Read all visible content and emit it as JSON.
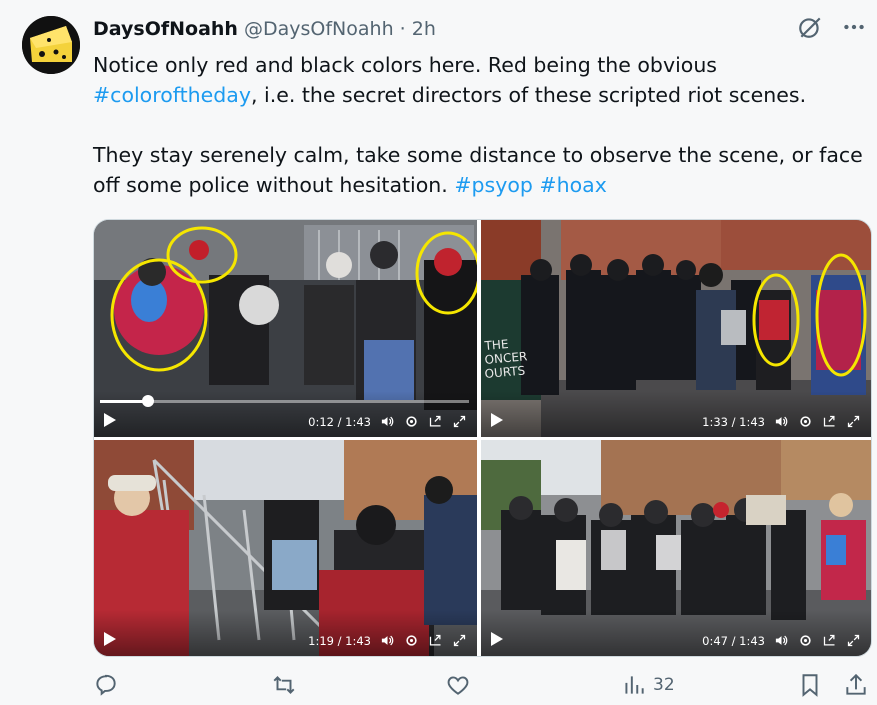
{
  "tweet": {
    "display_name": "DaysOfNoahh",
    "handle": "@DaysOfNoahh",
    "separator": "·",
    "time": "2h",
    "text_line1": "Notice only red and black colors here. Red being the obvious",
    "hashtag1": "#coloroftheday",
    "text_line2": ", i.e. the secret directors of these scripted riot scenes.",
    "text_line3": "They stay serenely calm, take some distance to observe the scene, or face off some police without hesitation.",
    "hashtag2": "#psyop",
    "hashtag3": "#hoax"
  },
  "videos": [
    {
      "time": "0:12 / 1:43",
      "progress": 0.13
    },
    {
      "time": "1:33 / 1:43",
      "progress": 0.0
    },
    {
      "time": "1:19 / 1:43",
      "progress": 0.0
    },
    {
      "time": "0:47 / 1:43",
      "progress": 0.0
    }
  ],
  "actions": {
    "views": "32"
  },
  "colors": {
    "link": "#1d9bf0",
    "muted": "#536471",
    "annotation_circle": "#f5e600"
  },
  "icons": [
    "grok-icon",
    "more-icon",
    "play-icon",
    "volume-icon",
    "settings-icon",
    "pip-icon",
    "fullscreen-icon",
    "reply-icon",
    "retweet-icon",
    "like-icon",
    "views-icon",
    "bookmark-icon",
    "share-icon"
  ]
}
